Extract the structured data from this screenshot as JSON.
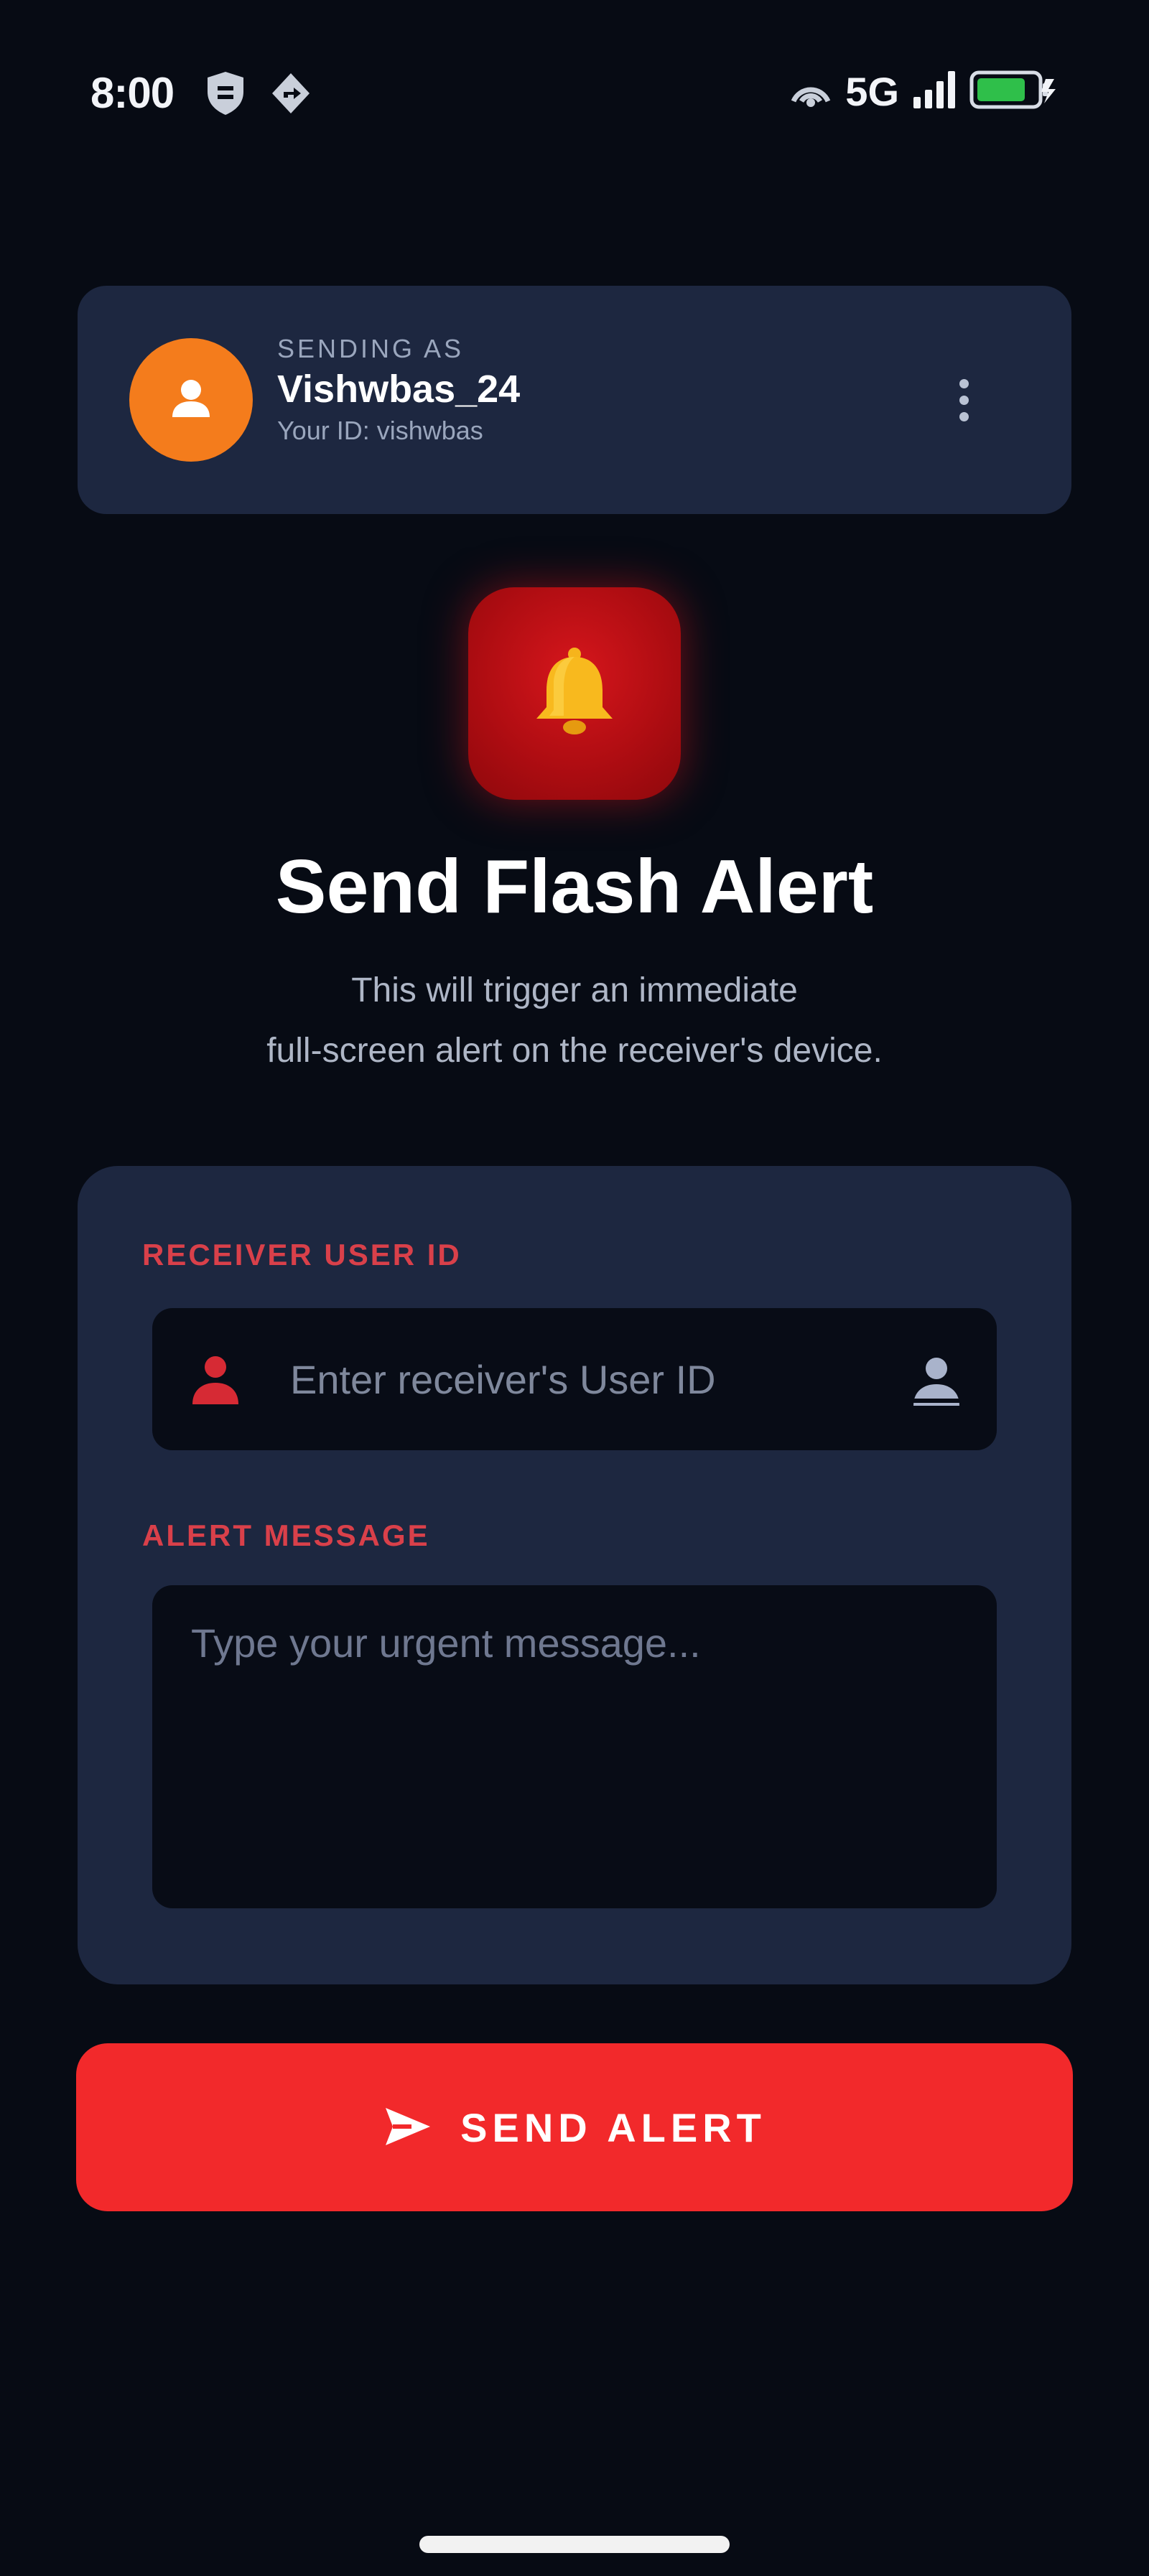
{
  "status_bar": {
    "time": "8:00",
    "network": "5G",
    "left_icons": [
      "shield-icon",
      "location-icon"
    ],
    "right_icons": [
      "hotspot-icon",
      "signal-icon",
      "battery-charging-icon"
    ]
  },
  "profile": {
    "sending_as_label": "SENDING AS",
    "username": "Vishwbas_24",
    "user_id": "Your ID: vishwbas",
    "avatar_color": "#f47c1c",
    "icons": [
      "user-icon",
      "more-vertical-icon"
    ]
  },
  "hero": {
    "icon": "bell-icon",
    "title": "Send Flash Alert",
    "subtitle_line1": "This will trigger an immediate",
    "subtitle_line2": "full-screen alert on the receiver's device."
  },
  "form": {
    "receiver_label": "RECEIVER USER ID",
    "receiver_placeholder": "Enter receiver's User ID",
    "receiver_value": "",
    "message_label": "ALERT MESSAGE",
    "message_placeholder": "Type your urgent message...",
    "message_value": "",
    "icons": [
      "user-icon",
      "contact-picker-icon"
    ]
  },
  "send_button": {
    "label": "SEND ALERT",
    "icon": "send-icon",
    "color": "#f2292b"
  },
  "colors": {
    "background": "#070b14",
    "card": "#1d2740",
    "accent_red": "#d9404a",
    "input_bg": "#080c16"
  }
}
